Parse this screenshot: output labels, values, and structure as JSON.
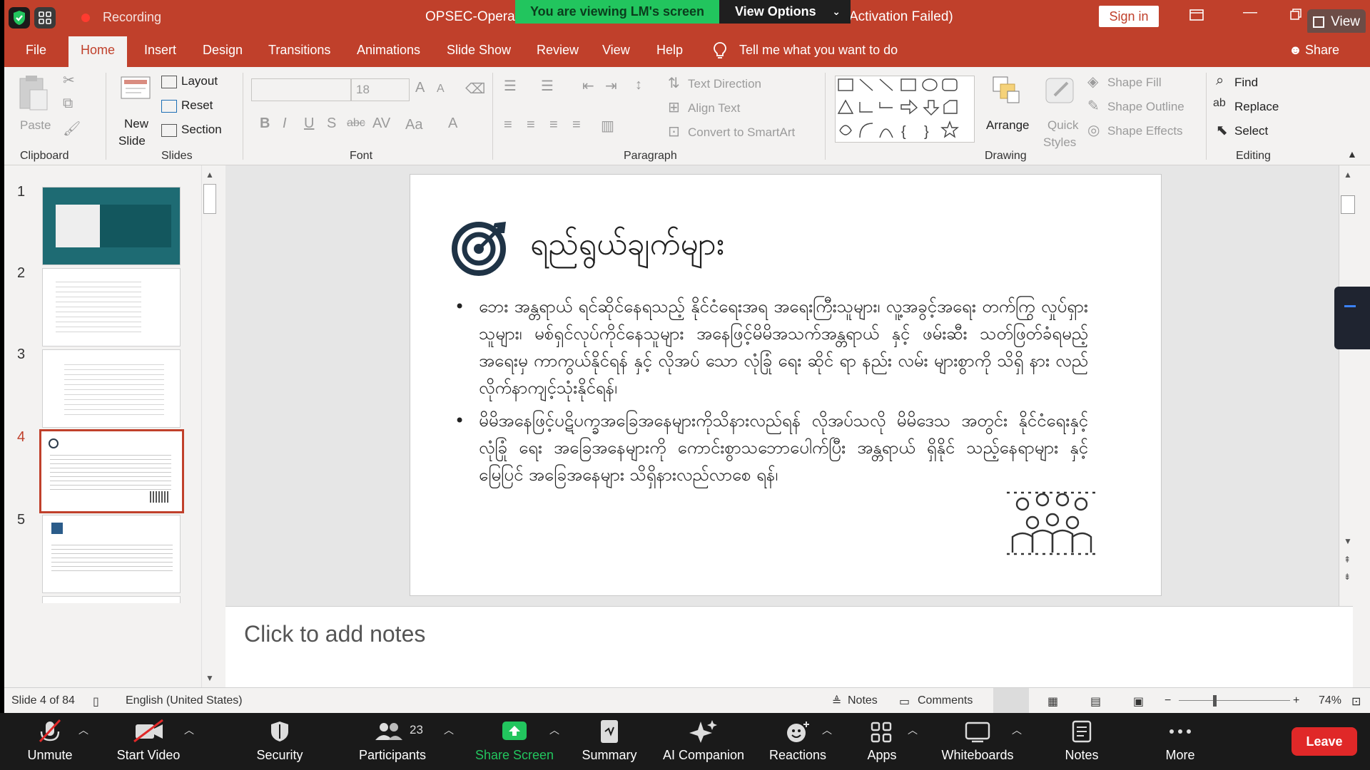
{
  "window": {
    "title": "OPSEC-Operatio",
    "title_suffix": "Activation Failed)",
    "sign_in": "Sign in",
    "recording_label": "Recording",
    "view_label": "View"
  },
  "share_banner": {
    "viewing_text": "You are viewing LM's screen",
    "view_options": "View Options"
  },
  "tabs": [
    {
      "label": "File"
    },
    {
      "label": "Home"
    },
    {
      "label": "Insert"
    },
    {
      "label": "Design"
    },
    {
      "label": "Transitions"
    },
    {
      "label": "Animations"
    },
    {
      "label": "Slide Show"
    },
    {
      "label": "Review"
    },
    {
      "label": "View"
    },
    {
      "label": "Help"
    }
  ],
  "tell_me": "Tell me what you want to do",
  "share_label": "Share",
  "ribbon": {
    "clipboard": {
      "paste": "Paste",
      "group": "Clipboard"
    },
    "slides": {
      "new_slide_1": "New",
      "new_slide_2": "Slide",
      "layout": "Layout",
      "reset": "Reset",
      "section": "Section",
      "group": "Slides"
    },
    "font": {
      "size": "18",
      "group": "Font",
      "aa": "Aa"
    },
    "paragraph": {
      "text_direction": "Text Direction",
      "align_text": "Align Text",
      "convert_smartart": "Convert to SmartArt",
      "group": "Paragraph"
    },
    "drawing": {
      "arrange": "Arrange",
      "quick_styles_1": "Quick",
      "quick_styles_2": "Styles",
      "shape_fill": "Shape Fill",
      "shape_outline": "Shape Outline",
      "shape_effects": "Shape Effects",
      "group": "Drawing"
    },
    "editing": {
      "find": "Find",
      "replace": "Replace",
      "select": "Select",
      "group": "Editing"
    }
  },
  "thumbnails": [
    {
      "number": "1"
    },
    {
      "number": "2"
    },
    {
      "number": "3"
    },
    {
      "number": "4"
    },
    {
      "number": "5"
    }
  ],
  "slide": {
    "title": "ရည်ရွယ်ချက်များ",
    "bullets": [
      "ဘေး အန္တရာယ် ရင်ဆိုင်နေရသည့် နိုင်ငံရေးအရ အရေးကြီးသူများ၊ လူ့အခွင့်အရေး တက်ကြွ လှုပ်ရှားသူများ၊ မစ်ရှင်လုပ်ကိုင်နေသူများ အနေဖြင့်မိမိအသက်အန္တရာယ် နှင့် ဖမ်းဆီး သတ်ဖြတ်ခံရမည့် အရေးမှ ကာကွယ်နိုင်ရန် နှင့် လိုအပ် သော လုံခြုံ ရေး ဆိုင် ရာ နည်း လမ်း များစွာကို သိရှိ နား လည် လိုက်နာကျင့်သုံးနိုင်ရန်၊",
      "မိမိအနေဖြင့်ပဋိပက္ခအခြေအနေများကိုသိနားလည်ရန် လိုအပ်သလို မိမိဒေသ အတွင်း နိုင်ငံရေးနှင့် လုံခြုံ ရေး အခြေအနေများကို ကောင်းစွာသဘောပေါက်ပြီး အန္တရာယ် ရှိနိုင် သည့်နေရာများ နှင့် မြေပြင် အခြေအနေများ သိရှိနားလည်လာစေ ရန်၊"
    ]
  },
  "notes_placeholder": "Click to add notes",
  "status": {
    "slide_count": "Slide 4 of 84",
    "language": "English (United States)",
    "notes": "Notes",
    "comments": "Comments",
    "zoom": "74%"
  },
  "zoom_toolbar": {
    "unmute": "Unmute",
    "start_video": "Start Video",
    "security": "Security",
    "participants": "Participants",
    "participants_count": "23",
    "share_screen": "Share Screen",
    "summary": "Summary",
    "ai_companion": "AI Companion",
    "reactions": "Reactions",
    "apps": "Apps",
    "whiteboards": "Whiteboards",
    "notes": "Notes",
    "more": "More",
    "leave": "Leave"
  },
  "colors": {
    "ppt_accent": "#c0402b",
    "zoom_green": "#22c55e",
    "leave_red": "#e02828"
  }
}
